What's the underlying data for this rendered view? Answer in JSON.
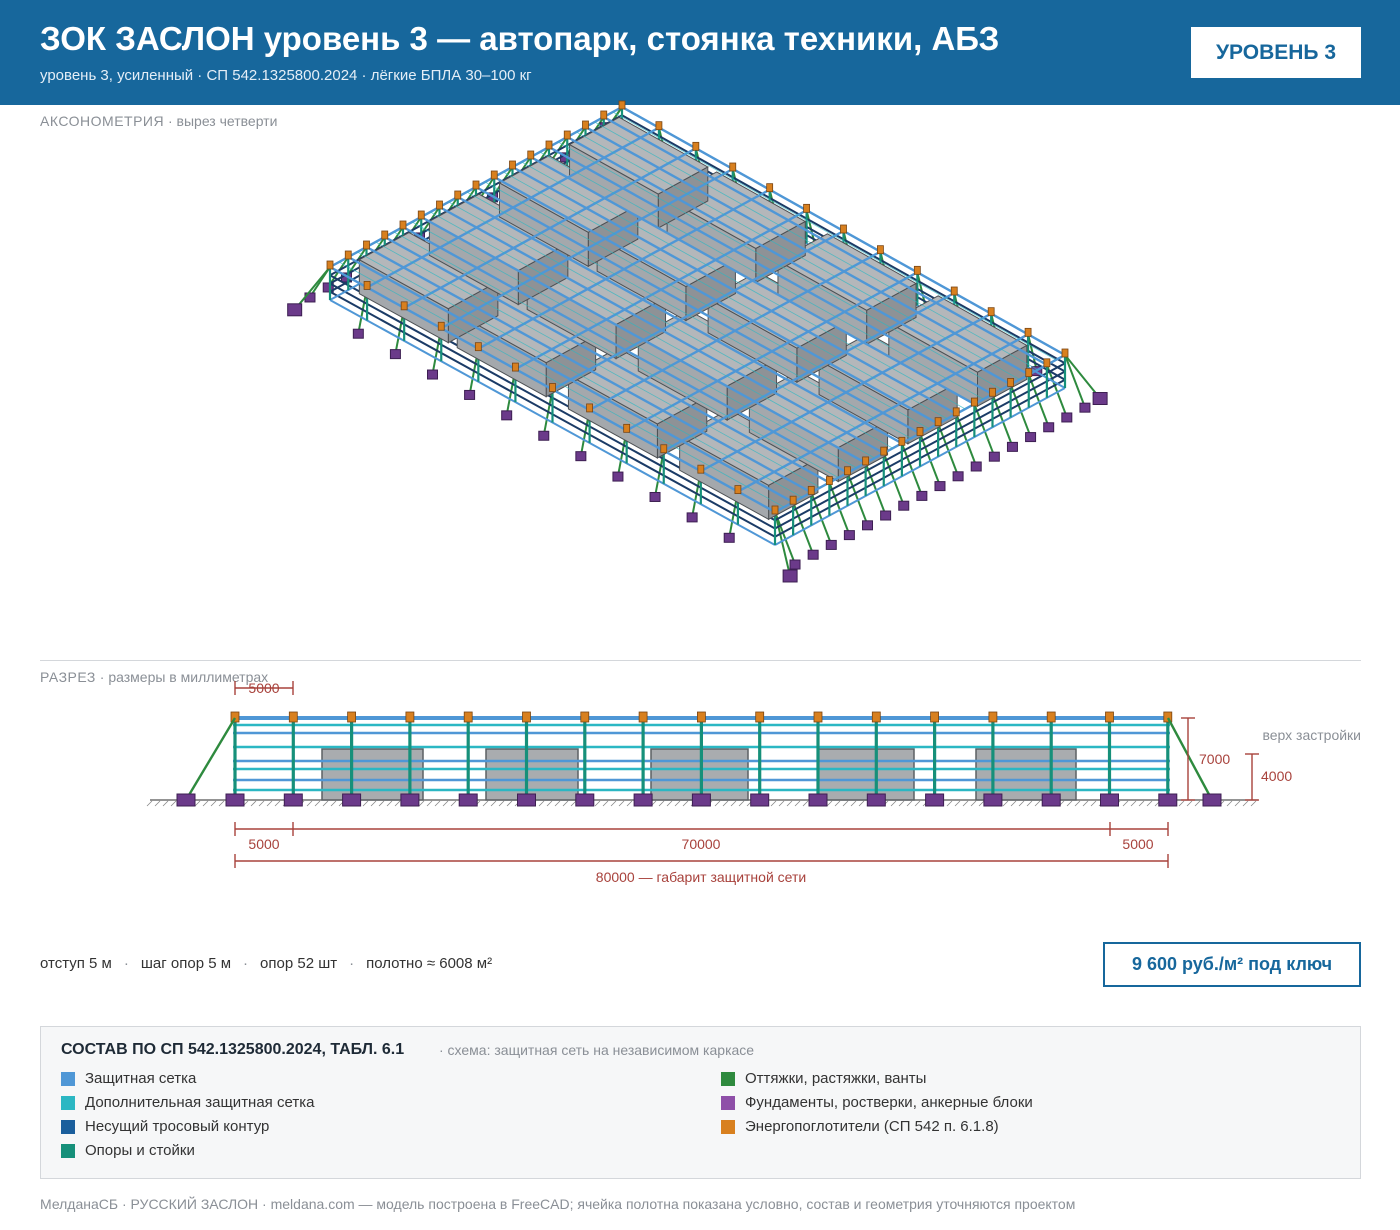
{
  "header": {
    "title": "ЗОК ЗАСЛОН уровень 3 — автопарк, стоянка техники, АБЗ",
    "subtitle": "уровень 3, усиленный · СП 542.1325800.2024 · лёгкие БПЛА 30–100 кг",
    "badge": "УРОВЕНЬ 3"
  },
  "axon": {
    "title": "АКСОНОМЕТРИЯ",
    "note": "· вырез четверти"
  },
  "section": {
    "title": "РАЗРЕЗ",
    "note": "· размеры в миллиметрах",
    "dims": {
      "top_span": "5000",
      "height": "7000",
      "building_height": "4000",
      "top_label": "верх застройки",
      "left": "5000",
      "middle": "70000",
      "right": "5000",
      "total": "80000 — габарит защитной сети"
    }
  },
  "stats": [
    "отступ 5 м",
    "шаг опор 5 м",
    "опор 52 шт",
    "полотно ≈ 6008 м²"
  ],
  "stats_separator": "·",
  "price": "9 600 руб./м² под ключ",
  "legend": {
    "title": "СОСТАВ ПО СП 542.1325800.2024, ТАБЛ. 6.1",
    "subtitle": "· схема: защитная сеть на независимом каркасе",
    "items": [
      {
        "label": "Защитная сетка",
        "color": "#4f97d6"
      },
      {
        "label": "Дополнительная защитная сетка",
        "color": "#2bb7c3"
      },
      {
        "label": "Несущий тросовый контур",
        "color": "#1a5e9c"
      },
      {
        "label": "Опоры и стойки",
        "color": "#16907a"
      },
      {
        "label": "Оттяжки, растяжки, ванты",
        "color": "#2e8a3e"
      },
      {
        "label": "Фундаменты, ростверки, анкерные блоки",
        "color": "#8e4fa8"
      },
      {
        "label": "Энергопоглотители (СП 542 п. 6.1.8)",
        "color": "#d8801f"
      }
    ]
  },
  "footer": "МелданаСБ · РУССКИЙ ЗАСЛОН · meldana.com — модель построена в FreeCAD; ячейка полотна показана условно, состав и геометрия уточняются проектом"
}
